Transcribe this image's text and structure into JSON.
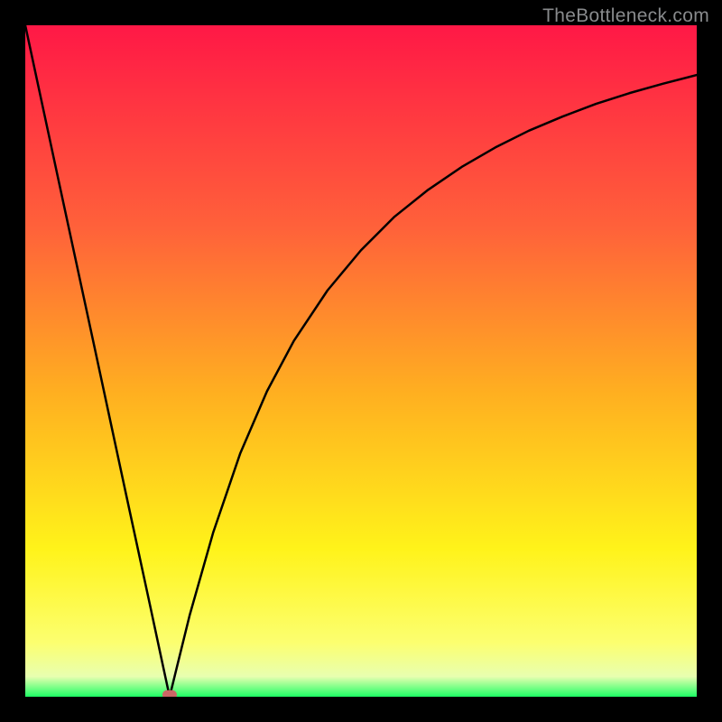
{
  "watermark": "TheBottleneck.com",
  "chart_data": {
    "type": "line",
    "title": "",
    "xlabel": "",
    "ylabel": "",
    "xlim": [
      0,
      1
    ],
    "ylim": [
      0,
      1
    ],
    "grid": false,
    "legend": false,
    "background_gradient": {
      "orientation": "vertical",
      "stops": [
        {
          "pos": 0.0,
          "color": "#ff1846"
        },
        {
          "pos": 0.3,
          "color": "#ff613a"
        },
        {
          "pos": 0.55,
          "color": "#ffb020"
        },
        {
          "pos": 0.78,
          "color": "#fff31a"
        },
        {
          "pos": 0.92,
          "color": "#fcff70"
        },
        {
          "pos": 0.97,
          "color": "#e8ffb0"
        },
        {
          "pos": 1.0,
          "color": "#1dff64"
        }
      ]
    },
    "marker": {
      "x": 0.215,
      "y": 0.003,
      "color": "#cc6666",
      "shape": "capsule"
    },
    "series": [
      {
        "name": "curve",
        "color": "#000000",
        "stroke_width": 2.5,
        "x": [
          0.0,
          0.05,
          0.1,
          0.15,
          0.185,
          0.204,
          0.215,
          0.226,
          0.245,
          0.28,
          0.32,
          0.36,
          0.4,
          0.45,
          0.5,
          0.55,
          0.6,
          0.65,
          0.7,
          0.75,
          0.8,
          0.85,
          0.9,
          0.95,
          1.0
        ],
        "values": [
          1.0,
          0.767,
          0.535,
          0.302,
          0.14,
          0.051,
          0.0,
          0.045,
          0.122,
          0.245,
          0.362,
          0.455,
          0.53,
          0.605,
          0.665,
          0.715,
          0.755,
          0.789,
          0.818,
          0.843,
          0.864,
          0.883,
          0.899,
          0.913,
          0.926
        ]
      }
    ]
  }
}
